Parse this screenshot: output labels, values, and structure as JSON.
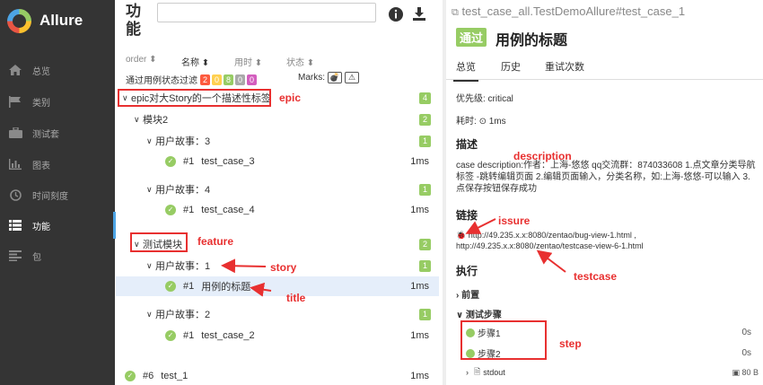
{
  "app": {
    "name": "Allure"
  },
  "sidebar": {
    "items": [
      {
        "label": "总览",
        "icon": "home-icon"
      },
      {
        "label": "类别",
        "icon": "flag-icon"
      },
      {
        "label": "测试套",
        "icon": "briefcase-icon"
      },
      {
        "label": "图表",
        "icon": "bar-chart-icon"
      },
      {
        "label": "时间刻度",
        "icon": "clock-icon"
      },
      {
        "label": "功能",
        "icon": "list-icon"
      },
      {
        "label": "包",
        "icon": "align-left-icon"
      }
    ]
  },
  "center": {
    "title": "功能",
    "search_value": "",
    "columns": {
      "order": "order",
      "name": "名称",
      "duration": "用时",
      "status": "状态"
    },
    "filter": {
      "label": "通过用例状态过滤",
      "badges": [
        {
          "value": "2",
          "color": "#fd5a3e"
        },
        {
          "value": "0",
          "color": "#ffd050"
        },
        {
          "value": "8",
          "color": "#97cc64"
        },
        {
          "value": "0",
          "color": "#aaaaaa"
        },
        {
          "value": "0",
          "color": "#d35ebe"
        }
      ],
      "marks_label": "Marks:"
    },
    "tree": {
      "epic": {
        "label": "epic对大Story的一个描述性标签",
        "count": "4"
      },
      "module2": {
        "label": "模块2",
        "count": "2"
      },
      "story3": {
        "label": "用户故事：3",
        "count": "1"
      },
      "tc3": {
        "num": "#1",
        "name": "test_case_3",
        "dur": "1ms"
      },
      "story4": {
        "label": "用户故事：4",
        "count": "1"
      },
      "tc4": {
        "num": "#1",
        "name": "test_case_4",
        "dur": "1ms"
      },
      "feature": {
        "label": "测试模块",
        "count": "2"
      },
      "story1": {
        "label": "用户故事：1",
        "count": "1"
      },
      "tc1": {
        "num": "#1",
        "name": "用例的标题",
        "dur": "1ms"
      },
      "story2": {
        "label": "用户故事：2",
        "count": "1"
      },
      "tc2": {
        "num": "#1",
        "name": "test_case_2",
        "dur": "1ms"
      },
      "t6": {
        "num": "#6",
        "name": "test_1",
        "dur": "1ms"
      }
    }
  },
  "detail": {
    "path": "test_case_all.TestDemoAllure#test_case_1",
    "status": "通过",
    "title": "用例的标题",
    "tabs": [
      "总览",
      "历史",
      "重试次数"
    ],
    "severity": "优先级: critical",
    "duration_label": "耗时:",
    "duration": "1ms",
    "description_head": "描述",
    "description": "case description:作者：上海-悠悠 qq交流群：874033608 1.点文章分类导航标签 -跳转编辑页面 2.编辑页面输入，分类名称，如:上海-悠悠-可以输入 3.点保存按钮保存成功",
    "links_head": "链接",
    "link1": "http://49.235.x.x:8080/zentao/bug-view-1.html ,",
    "link2": "http://49.235.x.x:8080/zentao/testcase-view-6-1.html",
    "exec_head": "执行",
    "setup": "前置",
    "steps_head": "测试步骤",
    "steps": [
      {
        "name": "步骤1",
        "dur": "0s"
      },
      {
        "name": "步骤2",
        "dur": "0s"
      }
    ],
    "stdout": "stdout",
    "stdout_size": "80 B"
  },
  "annotations": {
    "epic": "epic",
    "feature": "feature",
    "story": "story",
    "title": "title",
    "description": "description",
    "issure": "issure",
    "testcase": "testcase",
    "step": "step"
  }
}
